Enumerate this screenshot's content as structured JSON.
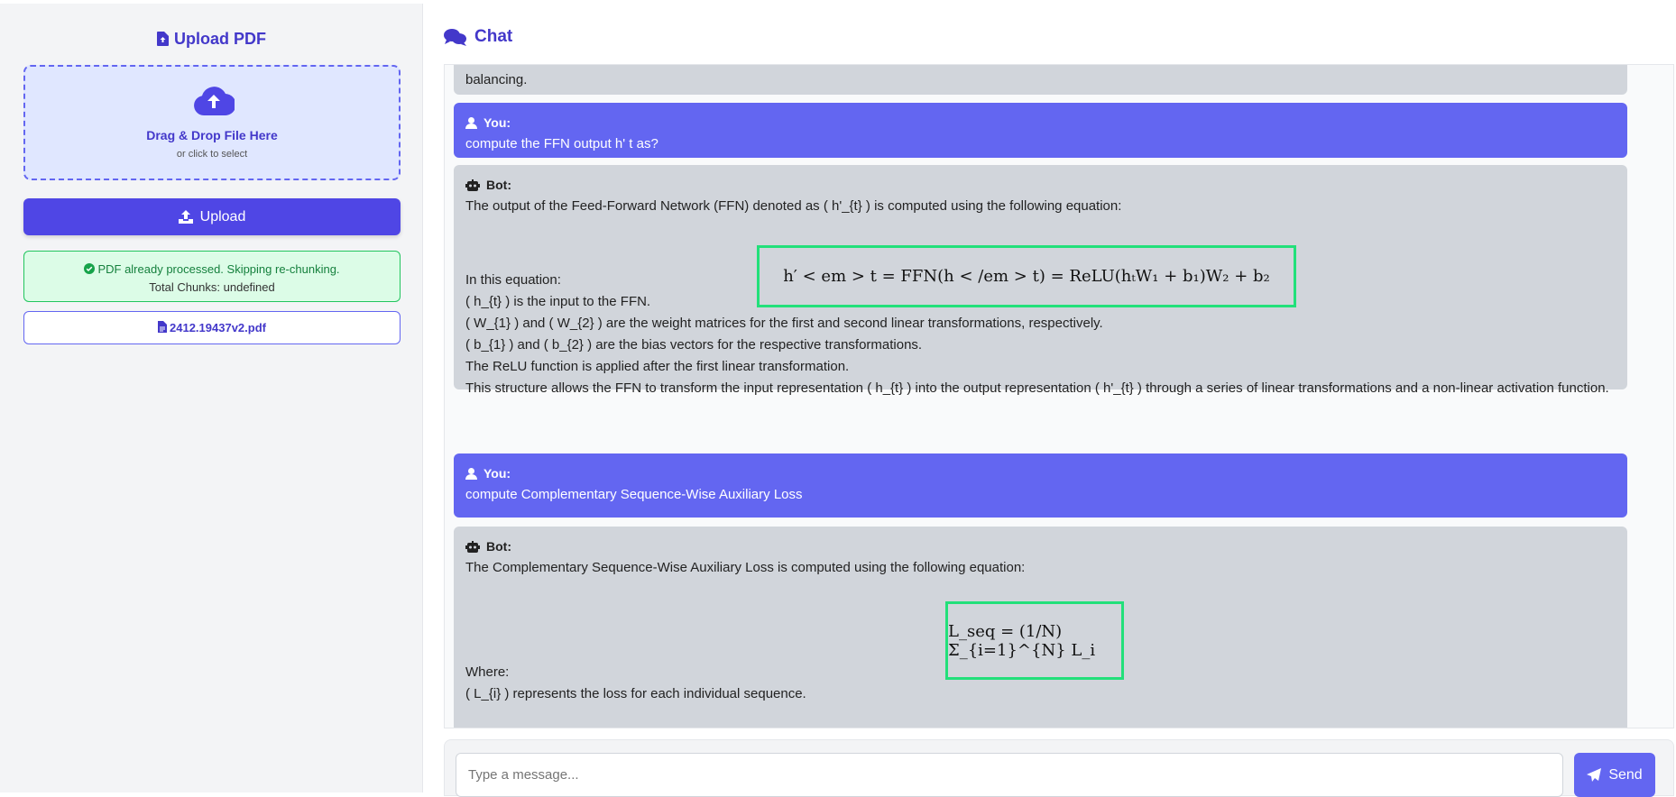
{
  "sidebar": {
    "title": "Upload PDF",
    "dropzone_main": "Drag & Drop File Here",
    "dropzone_sub": "or click to select",
    "upload_label": "Upload",
    "status_line1": "PDF already processed. Skipping re-chunking.",
    "status_line2": "Total Chunks: undefined",
    "file_name": "2412.19437v2.pdf"
  },
  "chat": {
    "title": "Chat",
    "messages": [
      {
        "role": "bot",
        "lines": [
          "balancing."
        ]
      },
      {
        "role": "user",
        "sender": "You:",
        "text": "compute the FFN output h' t as?"
      },
      {
        "role": "bot",
        "sender": "Bot:",
        "intro": "The output of the Feed-Forward Network (FFN) denoted as ( h'_{t} ) is computed using the following equation:",
        "equation": "h′ < em > t = FFN(h < /em > t) = ReLU(hₜW₁ + b₁)W₂ + b₂",
        "body": [
          "In this equation:",
          "( h_{t} ) is the input to the FFN.",
          "( W_{1} ) and ( W_{2} ) are the weight matrices for the first and second linear transformations, respectively.",
          "( b_{1} ) and ( b_{2} ) are the bias vectors for the respective transformations.",
          "The ReLU function is applied after the first linear transformation.",
          "This structure allows the FFN to transform the input representation ( h_{t} ) into the output representation ( h'_{t} ) through a series of linear transformations and a non-linear activation function."
        ]
      },
      {
        "role": "user",
        "sender": "You:",
        "text": "compute Complementary Sequence-Wise Auxiliary Loss"
      },
      {
        "role": "bot",
        "sender": "Bot:",
        "intro": "The Complementary Sequence-Wise Auxiliary Loss is computed using the following equation:",
        "equation": "L_seq = (1/N) Σ_{i=1}^{N} L_i",
        "body": [
          "Where:",
          "( L_{i} ) represents the loss for each individual sequence."
        ]
      }
    ]
  },
  "input": {
    "placeholder": "Type a message...",
    "send_label": "Send"
  },
  "colors": {
    "accent": "#4f46e5",
    "user_bubble": "#6366f1",
    "bot_bubble": "#d1d5db",
    "success": "#22c55e",
    "equation_highlight": "#22e07a"
  }
}
